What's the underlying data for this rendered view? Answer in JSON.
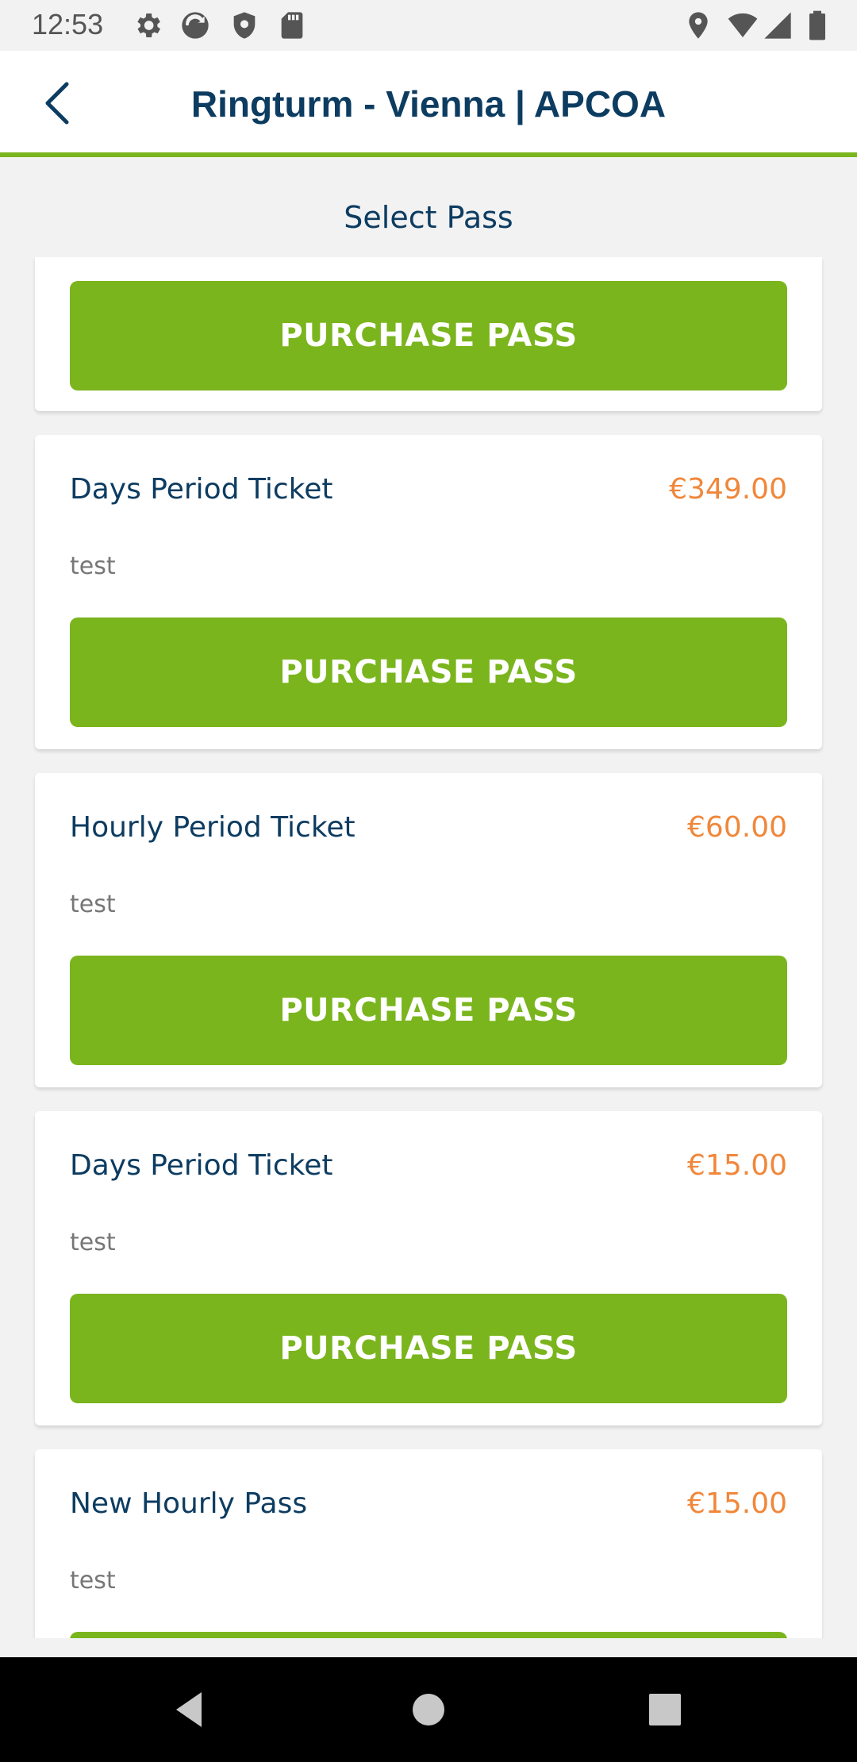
{
  "status_bar": {
    "time": "12:53",
    "left_icons": [
      "gear-icon",
      "sync-icon",
      "shield-icon",
      "sd-card-icon"
    ],
    "right_icons": [
      "location-icon",
      "wifi-icon",
      "cell-signal-icon",
      "battery-icon"
    ]
  },
  "header": {
    "title": "Ringturm - Vienna | APCOA",
    "back_icon": "chevron-left-icon"
  },
  "subtitle": "Select Pass",
  "purchase_label": "PURCHASE PASS",
  "passes": [
    {
      "name": "Days Period Ticket",
      "price": "€349.00",
      "description": "test"
    },
    {
      "name": "Hourly Period Ticket",
      "price": "€60.00",
      "description": "test"
    },
    {
      "name": "Days Period Ticket",
      "price": "€15.00",
      "description": "test"
    },
    {
      "name": "New Hourly Pass",
      "price": "€15.00",
      "description": "test"
    }
  ],
  "colors": {
    "accent_green": "#7ab51d",
    "title_navy": "#0d3c61",
    "price_orange": "#f0873a"
  },
  "nav_bar": [
    "back-triangle-icon",
    "home-circle-icon",
    "recents-square-icon"
  ]
}
